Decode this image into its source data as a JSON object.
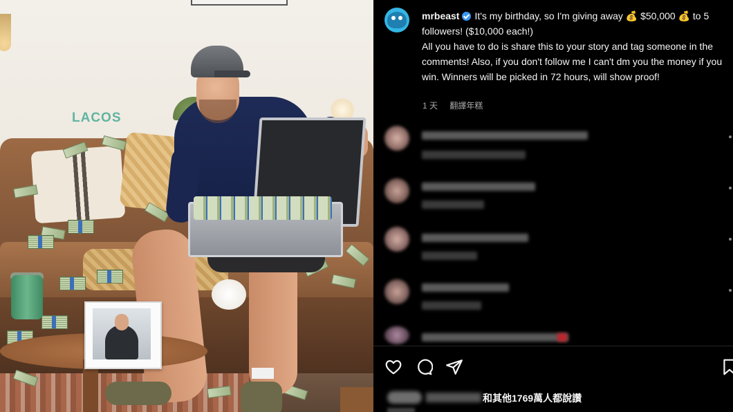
{
  "post": {
    "username": "mrbeast",
    "caption_line1": "It's my birthday, so I'm giving away ",
    "money_bag_emoji": "💰",
    "amount": "$50,000",
    "caption_line1_end": " to 5 followers! ($10,000 each!)",
    "caption_line2": "All you have to do is share this to your story and tag someone in the comments! Also, if you don't follow me I can't dm you the money if you win. Winners will be picked in 72 hours, will show proof!",
    "time_ago": "1 天",
    "translate_label": "翻譯年糕"
  },
  "photo": {
    "shirt_text": "LACOS"
  },
  "likes": {
    "text": "和其他1769萬人都說讚"
  },
  "icons": [
    "heart-icon",
    "comment-icon",
    "share-icon",
    "bookmark-icon",
    "verified-badge-icon"
  ],
  "colors": {
    "background": "#000000",
    "text": "#f5f5f5",
    "muted": "#a8a8a8",
    "verified": "#3897f0"
  }
}
